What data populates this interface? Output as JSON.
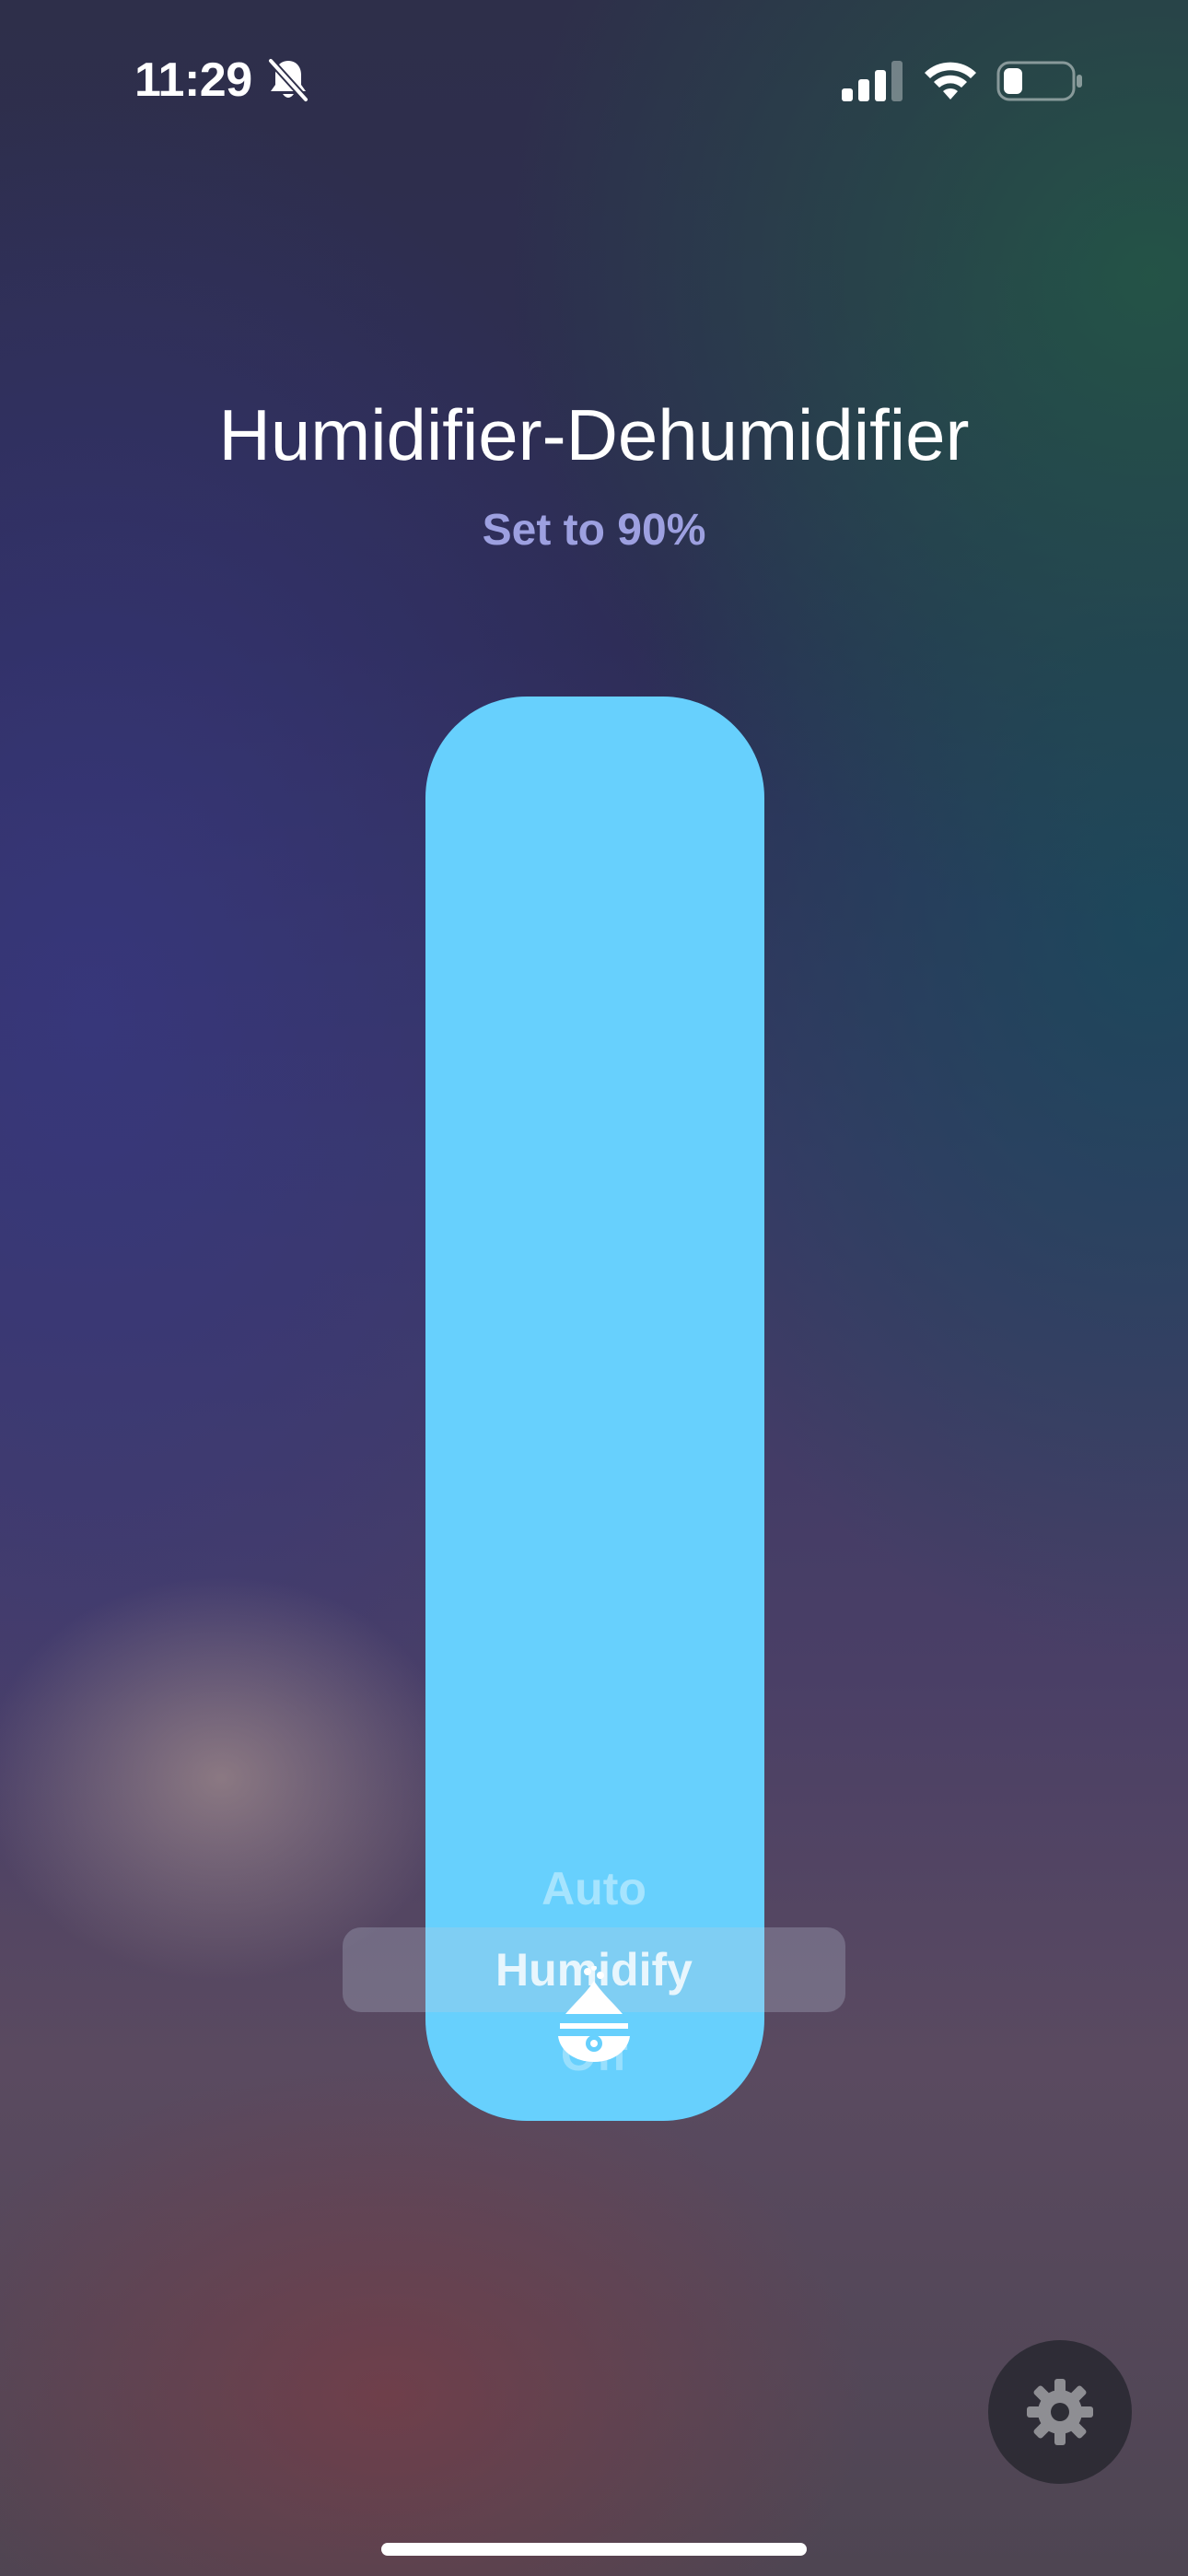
{
  "status_bar": {
    "time": "11:29",
    "icons": [
      "bell-slash-icon",
      "cellular-signal-icon",
      "wifi-icon",
      "battery-icon"
    ],
    "signal_bars_active": 3,
    "signal_bars_total": 4,
    "battery_level": 0.2
  },
  "accessory": {
    "name": "Humidifier-Dehumidifier",
    "status": "Set to 90%",
    "target_humidity_percent": 90
  },
  "slider": {
    "fill_fraction": 1.0,
    "fill_color": "#67d0fd",
    "icon": "humidifier-icon"
  },
  "mode_picker": {
    "options": [
      "Auto",
      "Humidify",
      "Off"
    ],
    "selected": "Humidify"
  },
  "settings": {
    "icon": "gear-icon"
  },
  "colors": {
    "accent": "#67d0fd",
    "subtitle": "#9da0e0"
  }
}
